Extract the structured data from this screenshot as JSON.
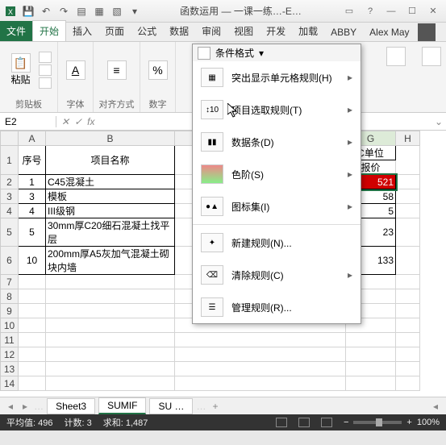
{
  "titlebar": {
    "title": "函数运用 — 一课一练…-E…"
  },
  "tabs": {
    "file": "文件",
    "items": [
      "开始",
      "插入",
      "页面",
      "公式",
      "数据",
      "审阅",
      "视图",
      "开发",
      "加载",
      "ABBY",
      "Alex May"
    ],
    "active_index": 0
  },
  "ribbon": {
    "groups": {
      "clipboard": {
        "paste": "粘贴",
        "label": "剪贴板"
      },
      "font": {
        "label": "字体",
        "letter": "A"
      },
      "align": {
        "label": "对齐方式"
      },
      "number": {
        "label": "数字"
      }
    },
    "conditional_format": {
      "title": "条件格式",
      "items": [
        {
          "label": "突出显示单元格规则(H)",
          "arrow": true
        },
        {
          "label": "项目选取规则(T)",
          "arrow": true
        },
        {
          "label": "数据条(D)",
          "arrow": true
        },
        {
          "label": "色阶(S)",
          "arrow": true
        },
        {
          "label": "图标集(I)",
          "arrow": true
        }
      ],
      "bottom": [
        {
          "label": "新建规则(N)..."
        },
        {
          "label": "清除规则(C)",
          "arrow": true
        },
        {
          "label": "管理规则(R)..."
        }
      ]
    }
  },
  "formula_bar": {
    "name_box": "E2",
    "fx": "fx"
  },
  "columns": [
    "A",
    "B",
    "",
    "G",
    "H"
  ],
  "sheet": {
    "headers": {
      "A": "序号",
      "B": "项目名称",
      "G_top": "C单位",
      "G_bot": "报价"
    },
    "rows": [
      {
        "n": "1",
        "a": "1",
        "b": "C45混凝土",
        "g": "521",
        "sel": true
      },
      {
        "n": "2",
        "a": "3",
        "b": "模板",
        "g": "58"
      },
      {
        "n": "3",
        "a": "4",
        "b": "III级钢",
        "g": "5"
      },
      {
        "n": "4",
        "a": "5",
        "b": "30mm厚C20细石混凝土找平层",
        "g": "23",
        "tall": true
      },
      {
        "n": "5",
        "a": "10",
        "b": "200mm厚A5灰加气混凝土砌块内墙",
        "g": "133",
        "tall": true
      },
      {
        "n": "6"
      },
      {
        "n": "7"
      },
      {
        "n": "8"
      },
      {
        "n": "9"
      },
      {
        "n": "10"
      },
      {
        "n": "11"
      },
      {
        "n": "12"
      },
      {
        "n": "13"
      }
    ]
  },
  "sheet_tabs": {
    "tabs": [
      "Sheet3",
      "SUMIF",
      "SU …"
    ],
    "new": "+"
  },
  "statusbar": {
    "avg_label": "平均值:",
    "avg": "496",
    "count_label": "计数:",
    "count": "3",
    "sum_label": "求和:",
    "sum": "1,487",
    "zoom": "100%"
  }
}
